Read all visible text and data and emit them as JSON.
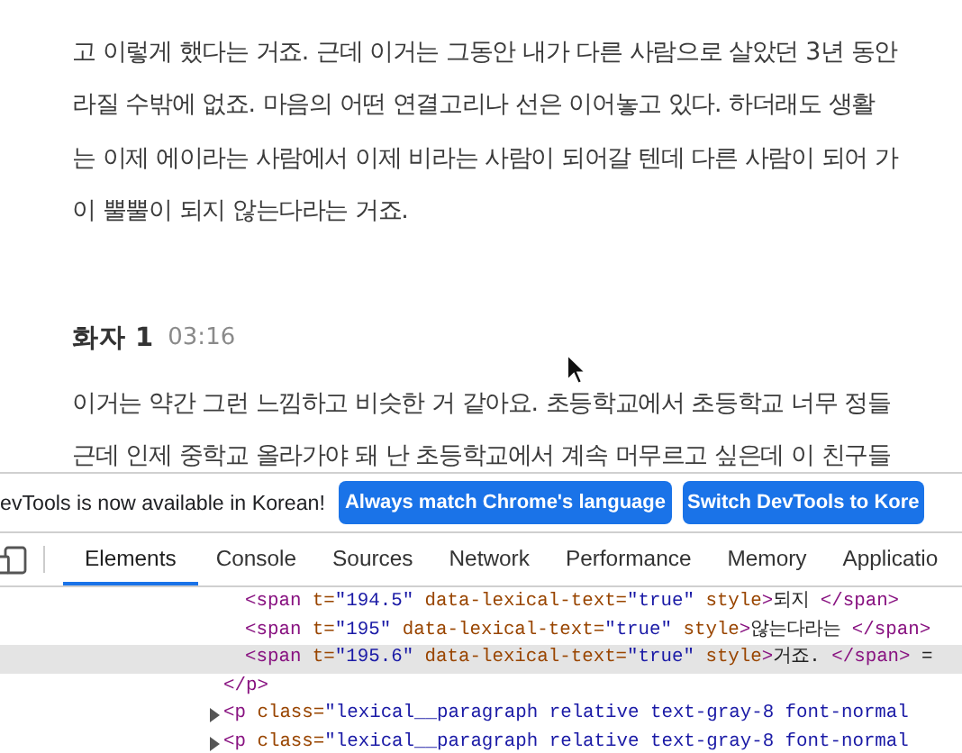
{
  "transcript": {
    "blocks": [
      {
        "kind": "paragraph",
        "lines": [
          "고 이렇게 했다는 거죠. 근데 이거는 그동안 내가 다른 사람으로 살았던 3년 동안",
          "라질 수밖에 없죠. 마음의 어떤 연결고리나 선은 이어놓고 있다. 하더래도 생활",
          "는 이제 에이라는 사람에서 이제 비라는 사람이 되어갈 텐데 다른 사람이 되어 가",
          "이 뿔뿔이 되지 않는다라는 거죠."
        ]
      },
      {
        "kind": "speaker",
        "name": "화자 1",
        "time": "03:16"
      },
      {
        "kind": "paragraph",
        "lines": [
          "이거는 약간 그런 느낌하고 비슷한 거 같아요. 초등학교에서 초등학교 너무 정들",
          "근데 인제 중학교 올라가야 돼 난 초등학교에서 계속 머무르고 싶은데 이 친구들"
        ]
      }
    ]
  },
  "devtools": {
    "banner": {
      "message": "evTools is now available in Korean!",
      "buttons": [
        "Always match Chrome's language",
        "Switch DevTools to Kore"
      ]
    },
    "tabs": [
      {
        "label": "Elements",
        "selected": true
      },
      {
        "label": "Console",
        "selected": false
      },
      {
        "label": "Sources",
        "selected": false
      },
      {
        "label": "Network",
        "selected": false
      },
      {
        "label": "Performance",
        "selected": false
      },
      {
        "label": "Memory",
        "selected": false
      },
      {
        "label": "Applicatio",
        "selected": false
      }
    ],
    "dom_tree": [
      {
        "expanded": true,
        "children": [
          {
            "selected": false,
            "tokens": [
              {
                "kind": "tag",
                "text": "<span"
              },
              {
                "kind": "attr",
                "text": " t="
              },
              {
                "kind": "value",
                "text": "\"194.5\""
              },
              {
                "kind": "attr",
                "text": " data-lexical-text="
              },
              {
                "kind": "value",
                "text": "\"true\""
              },
              {
                "kind": "attr",
                "text": " style"
              },
              {
                "kind": "tag",
                "text": ">"
              },
              {
                "kind": "text",
                "text": "되지 "
              },
              {
                "kind": "tag",
                "text": "</span>"
              }
            ]
          },
          {
            "selected": false,
            "tokens": [
              {
                "kind": "tag",
                "text": "<span"
              },
              {
                "kind": "attr",
                "text": " t="
              },
              {
                "kind": "value",
                "text": "\"195\""
              },
              {
                "kind": "attr",
                "text": " data-lexical-text="
              },
              {
                "kind": "value",
                "text": "\"true\""
              },
              {
                "kind": "attr",
                "text": " style"
              },
              {
                "kind": "tag",
                "text": ">"
              },
              {
                "kind": "text",
                "text": "않는다라는 "
              },
              {
                "kind": "tag",
                "text": "</span>"
              }
            ]
          },
          {
            "selected": true,
            "tokens": [
              {
                "kind": "tag",
                "text": "<span"
              },
              {
                "kind": "attr",
                "text": " t="
              },
              {
                "kind": "value",
                "text": "\"195.6\""
              },
              {
                "kind": "attr",
                "text": " data-lexical-text="
              },
              {
                "kind": "value",
                "text": "\"true\""
              },
              {
                "kind": "attr",
                "text": " style"
              },
              {
                "kind": "tag",
                "text": ">"
              },
              {
                "kind": "text",
                "text": "거죠. "
              },
              {
                "kind": "tag",
                "text": "</span>"
              },
              {
                "kind": "text",
                "text": " ="
              }
            ]
          }
        ],
        "close": [
          {
            "kind": "tag",
            "text": "</p>"
          }
        ]
      },
      {
        "expanded": false,
        "selected": false,
        "tokens": [
          {
            "kind": "tag",
            "text": "<p"
          },
          {
            "kind": "attr",
            "text": " class="
          },
          {
            "kind": "value",
            "text": "\"lexical__paragraph relative text-gray-8 font-normal"
          }
        ]
      },
      {
        "expanded": false,
        "selected": false,
        "tokens": [
          {
            "kind": "tag",
            "text": "<p"
          },
          {
            "kind": "attr",
            "text": " class="
          },
          {
            "kind": "value",
            "text": "\"lexical__paragraph relative text-gray-8 font-normal"
          }
        ]
      }
    ]
  }
}
